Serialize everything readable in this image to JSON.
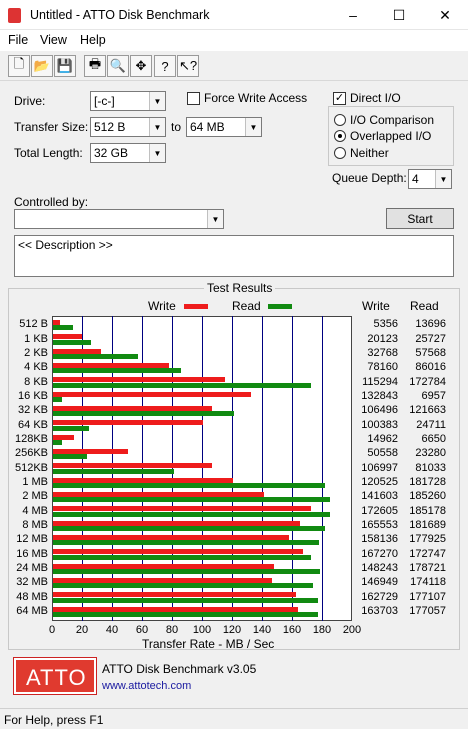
{
  "window": {
    "title": "Untitled - ATTO Disk Benchmark",
    "min": "–",
    "max": "☐",
    "close": "✕"
  },
  "menu": [
    "File",
    "View",
    "Help"
  ],
  "toolbar": {
    "icons": [
      "new-file-icon",
      "open-folder-icon",
      "save-icon",
      "print-icon",
      "print-preview-icon",
      "move-icon",
      "about-icon",
      "context-help-icon"
    ],
    "glyphs": [
      "🗋",
      "📂",
      "💾",
      "🖶",
      "🔍",
      "✥",
      "?",
      "↖?"
    ]
  },
  "settings": {
    "drive_label": "Drive:",
    "drive_value": "[-c-]",
    "transfer_label": "Transfer Size:",
    "transfer_from": "512 B",
    "to_label": "to",
    "transfer_to": "64 MB",
    "total_label": "Total Length:",
    "total_value": "32 GB",
    "force_write_label": "Force Write Access",
    "force_write_checked": false,
    "direct_io_label": "Direct I/O",
    "direct_io_checked": true,
    "io_comparison_label": "I/O Comparison",
    "overlapped_label": "Overlapped I/O",
    "neither_label": "Neither",
    "queue_label": "Queue Depth:",
    "queue_value": "4",
    "controlled_label": "Controlled by:",
    "controlled_value": "",
    "start_label": "Start",
    "description": "<< Description >>"
  },
  "results": {
    "group_title": "Test Results",
    "write_label": "Write",
    "read_label": "Read",
    "col_write": "Write",
    "col_read": "Read",
    "colors": {
      "write": "#ee1c1c",
      "read": "#118a11",
      "grid": "#000080"
    }
  },
  "chart_data": {
    "type": "bar",
    "xlabel": "Transfer Rate - MB / Sec",
    "xlim": [
      0,
      200
    ],
    "xticks": [
      "0",
      "20",
      "40",
      "60",
      "80",
      "100",
      "120",
      "140",
      "160",
      "180",
      "200"
    ],
    "categories": [
      "512 B",
      "1 KB",
      "2 KB",
      "4 KB",
      "8 KB",
      "16 KB",
      "32 KB",
      "64 KB",
      "128KB",
      "256KB",
      "512KB",
      "1 MB",
      "2 MB",
      "4 MB",
      "8 MB",
      "12 MB",
      "16 MB",
      "24 MB",
      "32 MB",
      "48 MB",
      "64 MB"
    ],
    "series": [
      {
        "name": "Write",
        "values": [
          5356,
          20123,
          32768,
          78160,
          115294,
          132843,
          106496,
          100383,
          14962,
          50558,
          106997,
          120525,
          141603,
          172605,
          165553,
          158136,
          167270,
          148243,
          146949,
          162729,
          163703
        ]
      },
      {
        "name": "Read",
        "values": [
          13696,
          25727,
          57568,
          86016,
          172784,
          6957,
          121663,
          24711,
          6650,
          23280,
          81033,
          181728,
          185260,
          185178,
          181689,
          177925,
          172747,
          178721,
          174118,
          177107,
          177057
        ]
      }
    ],
    "value_unit_divisor": 1000
  },
  "footer": {
    "logo_text": "ATTO",
    "product": "ATTO Disk Benchmark v3.05",
    "link": "www.attotech.com"
  },
  "status": "For Help, press F1"
}
